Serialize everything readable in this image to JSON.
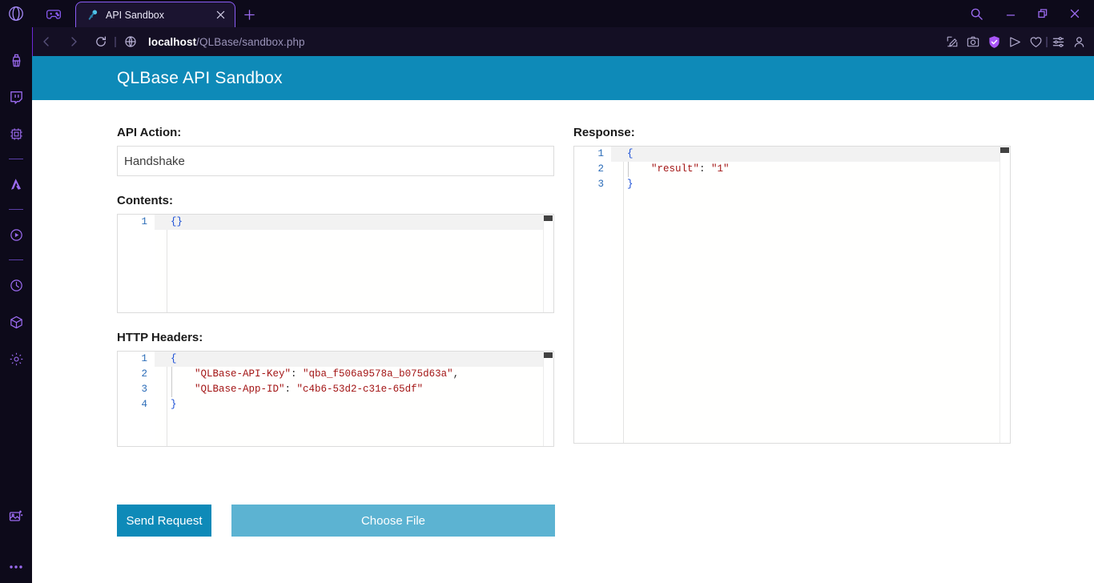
{
  "browser": {
    "opera_logo": "opera-logo",
    "pinned_tab_icon": "gamepad-icon",
    "tab": {
      "title": "API Sandbox",
      "favicon": "key-icon",
      "close_label": "×"
    },
    "new_tab_label": "+",
    "window_controls": {
      "search": "search-icon",
      "minimize": "minimize-icon",
      "maximize": "restore-icon",
      "close": "close-icon"
    },
    "address_bar": {
      "back": "back-arrow-icon",
      "forward": "forward-arrow-icon",
      "reload": "reload-icon",
      "site_info": "globe-icon",
      "url_host": "localhost",
      "url_path": "/QLBase/sandbox.php",
      "actions": [
        "edit-pin-icon",
        "screenshot-icon",
        "vpn-shield-icon",
        "send-to-device-icon",
        "heart-icon",
        "easy-setup-icon",
        "profile-icon"
      ]
    },
    "sidebar": {
      "items": [
        "broom-icon",
        "twitch-icon",
        "cpu-icon",
        "divider",
        "aria-ai-icon",
        "divider",
        "player-icon",
        "divider",
        "history-icon",
        "box-icon",
        "settings-icon"
      ],
      "bottom_items": [
        "image-effects-icon",
        "more-icon"
      ]
    }
  },
  "page": {
    "header": {
      "title": "QLBase API Sandbox",
      "color": "#0e8ab8"
    },
    "api_action": {
      "label": "API Action:",
      "value": "Handshake",
      "placeholder": ""
    },
    "contents": {
      "label": "Contents:",
      "lines": [
        {
          "n": "1",
          "active": true,
          "tokens": [
            {
              "t": "{}",
              "c": "tok-brace"
            }
          ]
        }
      ]
    },
    "http_headers": {
      "label": "HTTP Headers:",
      "lines": [
        {
          "n": "1",
          "active": true,
          "tokens": [
            {
              "t": "{",
              "c": "tok-brace"
            }
          ]
        },
        {
          "n": "2",
          "active": false,
          "tokens": [
            {
              "t": "    \"QLBase-API-Key\"",
              "c": "tok-key"
            },
            {
              "t": ": ",
              "c": "tok-punct"
            },
            {
              "t": "\"qba_f506a9578a_b075d63a\"",
              "c": "tok-str"
            },
            {
              "t": ",",
              "c": "tok-punct"
            }
          ]
        },
        {
          "n": "3",
          "active": false,
          "tokens": [
            {
              "t": "    \"QLBase-App-ID\"",
              "c": "tok-key"
            },
            {
              "t": ": ",
              "c": "tok-punct"
            },
            {
              "t": "\"c4b6-53d2-c31e-65df\"",
              "c": "tok-str"
            }
          ]
        },
        {
          "n": "4",
          "active": false,
          "tokens": [
            {
              "t": "}",
              "c": "tok-brace"
            }
          ]
        }
      ]
    },
    "response": {
      "label": "Response:",
      "lines": [
        {
          "n": "1",
          "active": true,
          "tokens": [
            {
              "t": "{",
              "c": "tok-brace"
            }
          ]
        },
        {
          "n": "2",
          "active": false,
          "tokens": [
            {
              "t": "    \"result\"",
              "c": "tok-key"
            },
            {
              "t": ": ",
              "c": "tok-punct"
            },
            {
              "t": "\"1\"",
              "c": "tok-str"
            }
          ]
        },
        {
          "n": "3",
          "active": false,
          "tokens": [
            {
              "t": "}",
              "c": "tok-brace"
            }
          ]
        }
      ]
    },
    "buttons": {
      "send_request": "Send Request",
      "choose_file": "Choose File",
      "send_color": "#0e8ab8",
      "choose_color": "#5cb3d2"
    }
  }
}
